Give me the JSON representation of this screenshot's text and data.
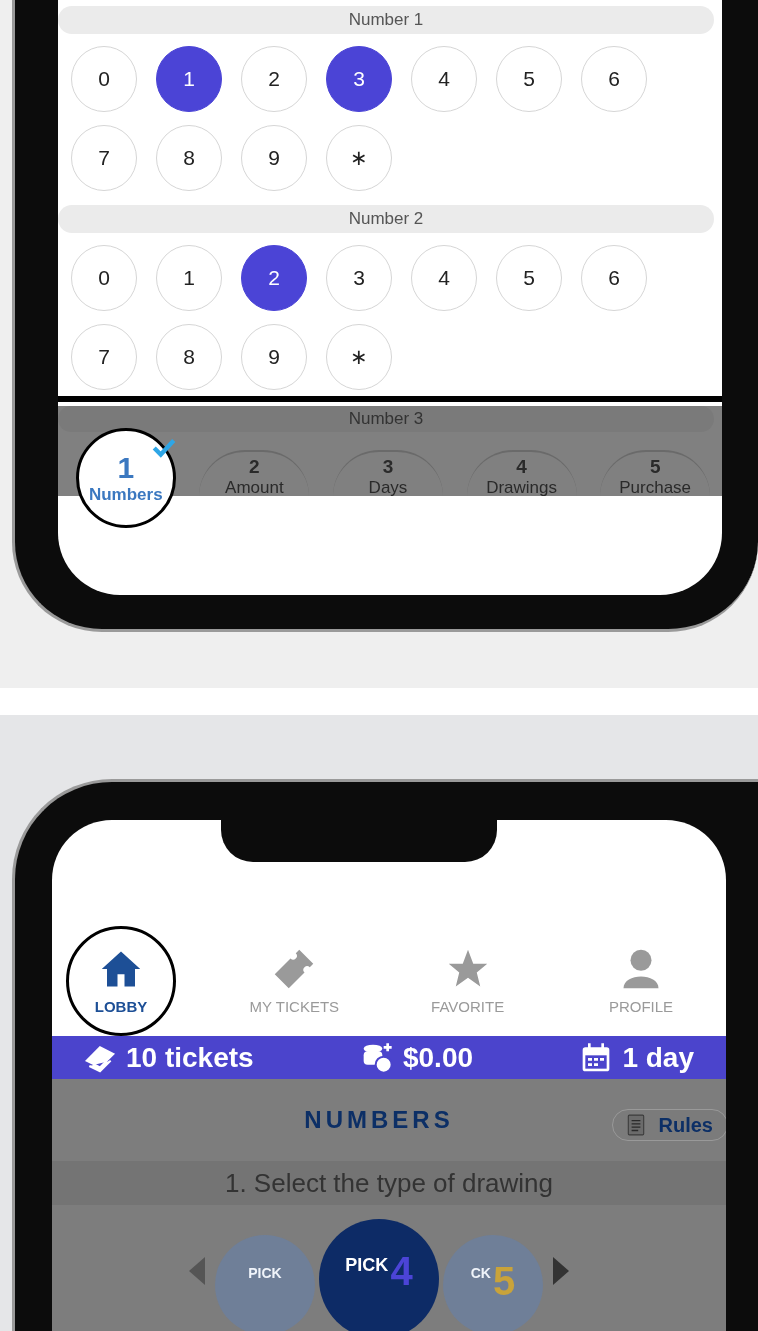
{
  "pickers": [
    {
      "label": "Number 1",
      "balls": [
        {
          "label": "0",
          "selected": false
        },
        {
          "label": "1",
          "selected": true
        },
        {
          "label": "2",
          "selected": false
        },
        {
          "label": "3",
          "selected": true
        },
        {
          "label": "4",
          "selected": false
        },
        {
          "label": "5",
          "selected": false
        },
        {
          "label": "6",
          "selected": false
        },
        {
          "label": "7",
          "selected": false
        },
        {
          "label": "8",
          "selected": false
        },
        {
          "label": "9",
          "selected": false
        },
        {
          "label": "∗",
          "selected": false
        }
      ]
    },
    {
      "label": "Number 2",
      "balls": [
        {
          "label": "0",
          "selected": false
        },
        {
          "label": "1",
          "selected": false
        },
        {
          "label": "2",
          "selected": true
        },
        {
          "label": "3",
          "selected": false
        },
        {
          "label": "4",
          "selected": false
        },
        {
          "label": "5",
          "selected": false
        },
        {
          "label": "6",
          "selected": false
        },
        {
          "label": "7",
          "selected": false
        },
        {
          "label": "8",
          "selected": false
        },
        {
          "label": "9",
          "selected": false
        },
        {
          "label": "∗",
          "selected": false
        }
      ]
    }
  ],
  "next_picker": {
    "label": "Number 3"
  },
  "steps": [
    {
      "number": "1",
      "label": "Numbers",
      "selected": true
    },
    {
      "number": "2",
      "label": "Amount",
      "selected": false
    },
    {
      "number": "3",
      "label": "Days",
      "selected": false
    },
    {
      "number": "4",
      "label": "Drawings",
      "selected": false
    },
    {
      "number": "5",
      "label": "Purchase",
      "selected": false
    }
  ],
  "nav": [
    {
      "label": "LOBBY",
      "selected": true
    },
    {
      "label": "MY TICKETS",
      "selected": false
    },
    {
      "label": "FAVORITE",
      "selected": false
    },
    {
      "label": "PROFILE",
      "selected": false
    }
  ],
  "summary": [
    {
      "text": "10 tickets"
    },
    {
      "text": "$0.00"
    },
    {
      "text": "1 day"
    }
  ],
  "section": {
    "title": "NUMBERS",
    "rules_button": "Rules",
    "instruction": "1. Select the type of drawing"
  },
  "games": [
    {
      "label": "PICK",
      "selected": false
    },
    {
      "label": "PICK",
      "number": "4",
      "selected": true
    },
    {
      "label": "CK",
      "number": "5",
      "selected": false
    }
  ]
}
